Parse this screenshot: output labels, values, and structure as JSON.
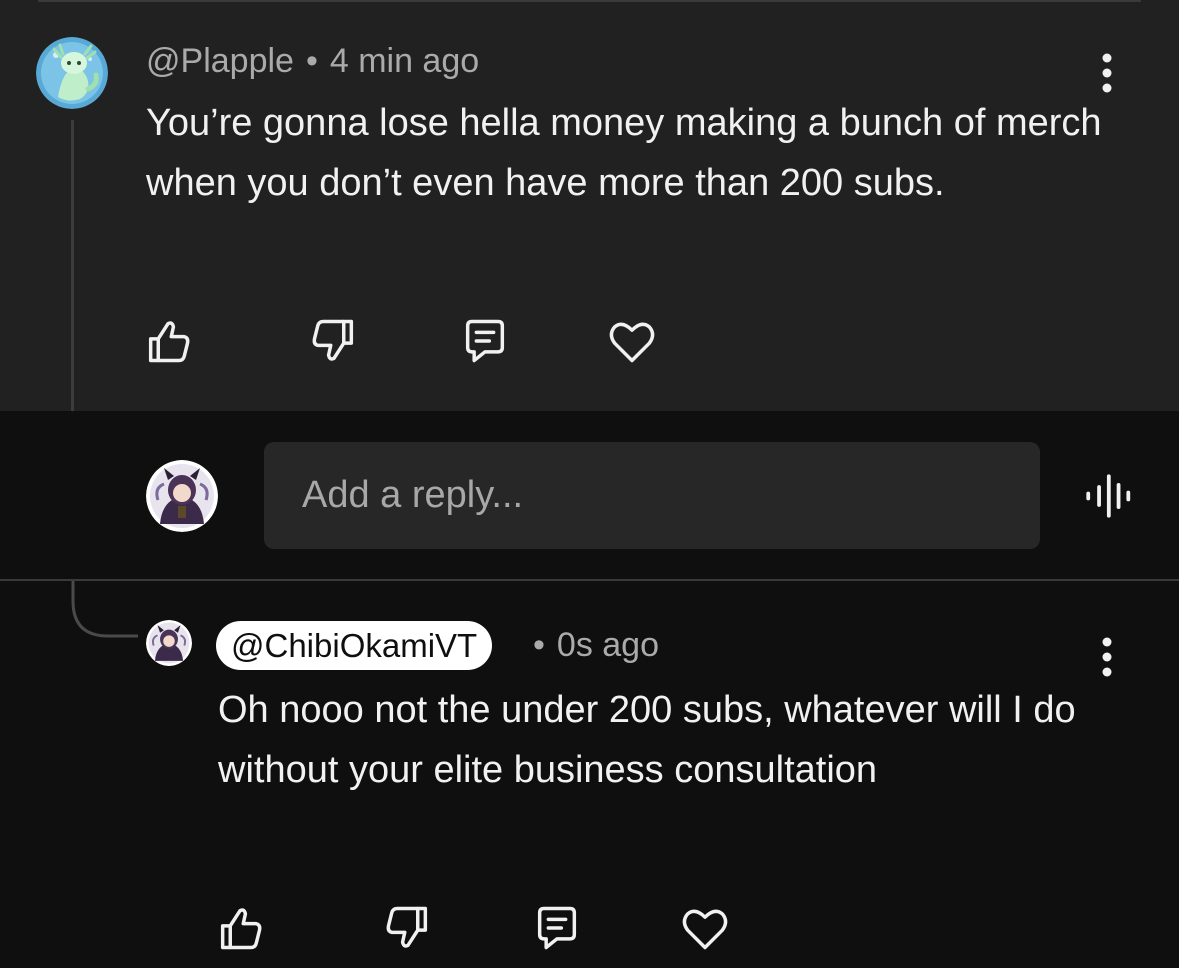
{
  "comment": {
    "author": "@Plapple",
    "separator": "•",
    "timestamp": "4 min ago",
    "text": "You’re gonna lose hella money making a bunch of merch when you don’t even have more than 200 subs.",
    "actions": [
      "thumbs-up-icon",
      "thumbs-down-icon",
      "reply-icon",
      "heart-icon"
    ]
  },
  "reply_box": {
    "placeholder": "Add a reply...",
    "voice_icon": "voice-search-icon"
  },
  "reply": {
    "author": "@ChibiOkamiVT",
    "separator": "•",
    "timestamp": "0s ago",
    "text": "Oh nooo not the under 200 subs, whatever will I do without your elite business consultation",
    "actions": [
      "thumbs-up-icon",
      "thumbs-down-icon",
      "reply-icon",
      "heart-icon"
    ]
  },
  "colors": {
    "comment_bg": "#212121",
    "page_bg": "#0f0f0f",
    "text": "#f1f1f1",
    "meta_text": "#aaaaaa",
    "input_bg": "#272727",
    "pill_bg": "#ffffff"
  }
}
